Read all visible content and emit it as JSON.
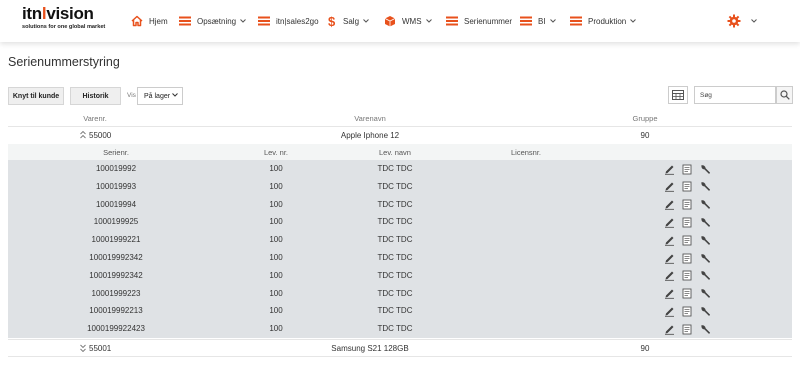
{
  "app": {
    "logo_prefix": "itn",
    "logo_bar": "l",
    "logo_suffix": "vision",
    "logo_tagline": "solutions for one global market",
    "accent_color": "#e8511c"
  },
  "nav": {
    "items": [
      {
        "label": "Hjem",
        "icon": "home-icon",
        "dropdown": false
      },
      {
        "label": "Opsætning",
        "icon": "menu-lines-icon",
        "dropdown": true
      },
      {
        "label": "itn|sales2go",
        "icon": "menu-lines-icon",
        "dropdown": false
      },
      {
        "label": "Salg",
        "icon": "dollar-icon",
        "dropdown": true
      },
      {
        "label": "WMS",
        "icon": "box-icon",
        "dropdown": true
      },
      {
        "label": "Serienummer",
        "icon": "menu-lines-icon",
        "dropdown": false
      },
      {
        "label": "BI",
        "icon": "menu-lines-icon",
        "dropdown": true
      },
      {
        "label": "Produktion",
        "icon": "menu-lines-icon",
        "dropdown": true
      }
    ],
    "settings_icon": "gear-icon"
  },
  "page": {
    "title": "Serienummerstyring"
  },
  "toolbar": {
    "knyt_label": "Knyt til kunde",
    "historik_label": "Historik",
    "vis_label": "Vis",
    "filter_value": "På lager",
    "search_placeholder": "Søg"
  },
  "table": {
    "columns": {
      "varenr": "Varenr.",
      "varenavn": "Varenavn",
      "gruppe": "Gruppe"
    },
    "sub_columns": {
      "serienr": "Serienr.",
      "lev_nr": "Lev. nr.",
      "lev_navn": "Lev. navn",
      "licensnr": "Licensnr."
    },
    "groups": [
      {
        "varenr": "55000",
        "varenavn": "Apple Iphone 12",
        "gruppe": "90",
        "expanded": true,
        "serials": [
          {
            "serienr": "100019992",
            "lev_nr": "100",
            "lev_navn": "TDC TDC",
            "licensnr": ""
          },
          {
            "serienr": "100019993",
            "lev_nr": "100",
            "lev_navn": "TDC TDC",
            "licensnr": ""
          },
          {
            "serienr": "100019994",
            "lev_nr": "100",
            "lev_navn": "TDC TDC",
            "licensnr": ""
          },
          {
            "serienr": "1000199925",
            "lev_nr": "100",
            "lev_navn": "TDC TDC",
            "licensnr": ""
          },
          {
            "serienr": "10001999221",
            "lev_nr": "100",
            "lev_navn": "TDC TDC",
            "licensnr": ""
          },
          {
            "serienr": "100019992342",
            "lev_nr": "100",
            "lev_navn": "TDC TDC",
            "licensnr": ""
          },
          {
            "serienr": "100019992342",
            "lev_nr": "100",
            "lev_navn": "TDC TDC",
            "licensnr": ""
          },
          {
            "serienr": "10001999223",
            "lev_nr": "100",
            "lev_navn": "TDC TDC",
            "licensnr": ""
          },
          {
            "serienr": "100019992213",
            "lev_nr": "100",
            "lev_navn": "TDC TDC",
            "licensnr": ""
          },
          {
            "serienr": "1000199922423",
            "lev_nr": "100",
            "lev_navn": "TDC TDC",
            "licensnr": ""
          }
        ]
      },
      {
        "varenr": "55001",
        "varenavn": "Samsung S21 128GB",
        "gruppe": "90",
        "expanded": false,
        "serials": []
      }
    ],
    "row_actions": [
      "pencil-icon",
      "note-icon",
      "wrench-icon"
    ]
  }
}
